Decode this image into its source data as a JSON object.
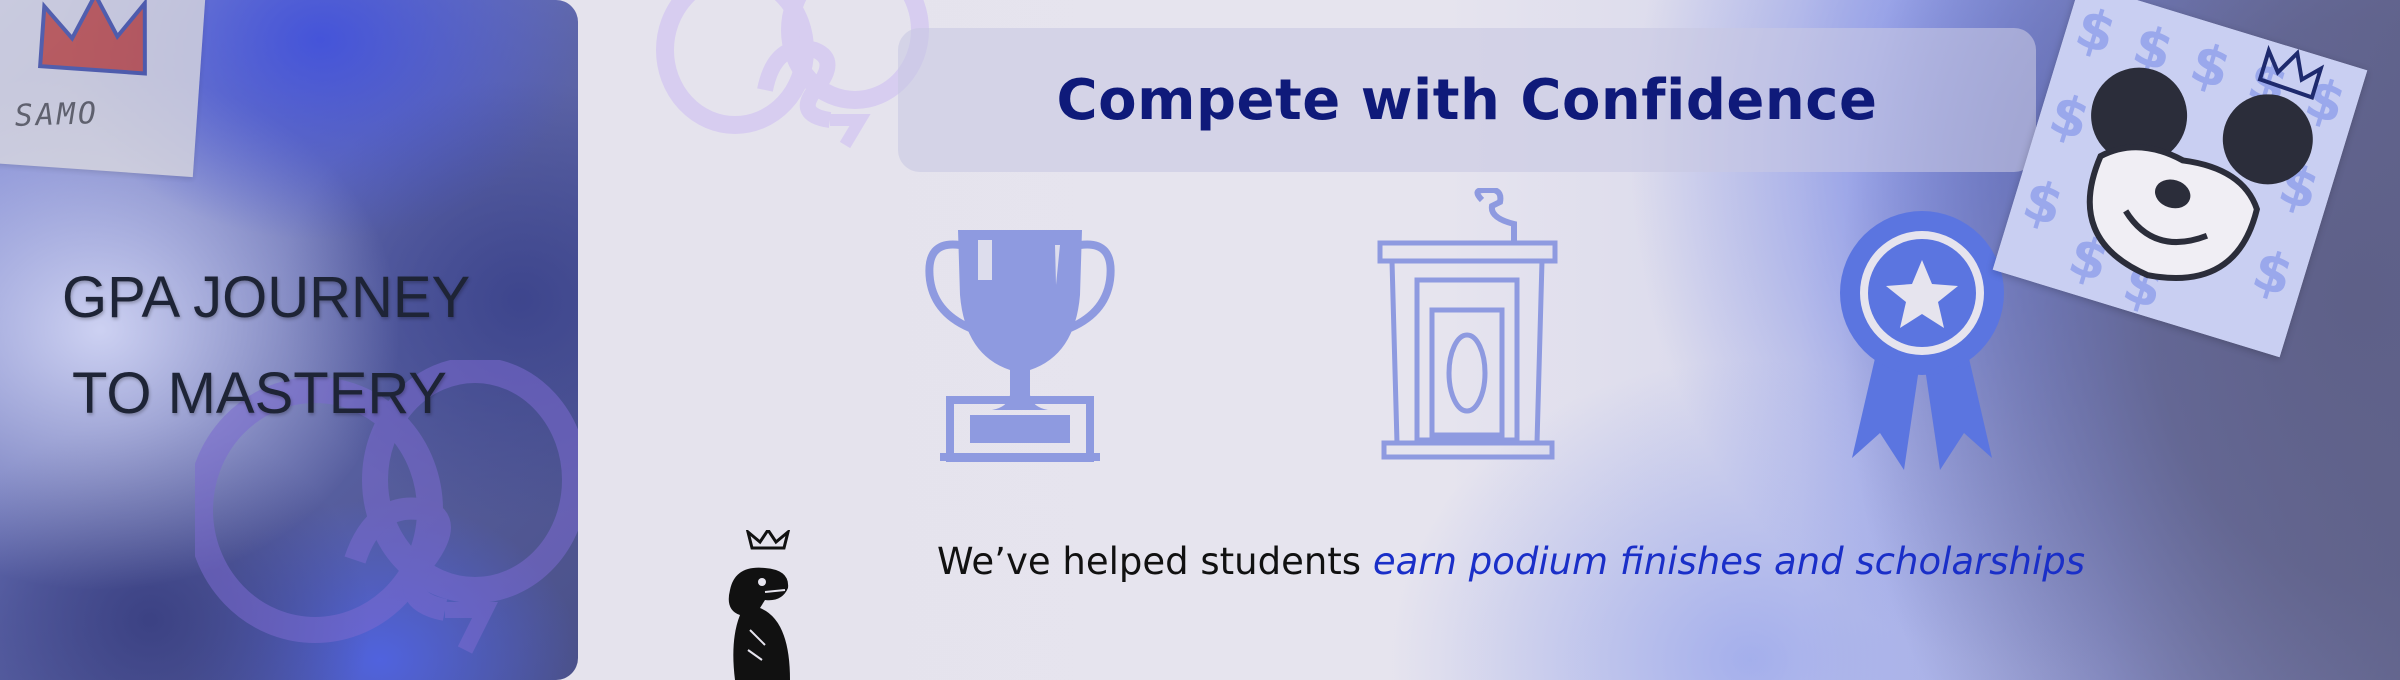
{
  "left_panel": {
    "title_line1": "GPA JOURNEY",
    "title_line2": "TO MASTERY",
    "samo_text": "SAMO"
  },
  "banner": {
    "title": "Compete with Confidence"
  },
  "icons": {
    "trophy": "trophy-icon",
    "podium": "podium-icon",
    "medal": "award-medal-icon"
  },
  "tagline": {
    "plain": "We’ve helped students ",
    "emphasis": "earn podium finishes and scholarships"
  },
  "colors": {
    "banner_title": "#0f1a7a",
    "icon_fill": "#8e9ae0",
    "medal_fill": "#5b75e0",
    "emphasis": "#1a2fc8"
  }
}
